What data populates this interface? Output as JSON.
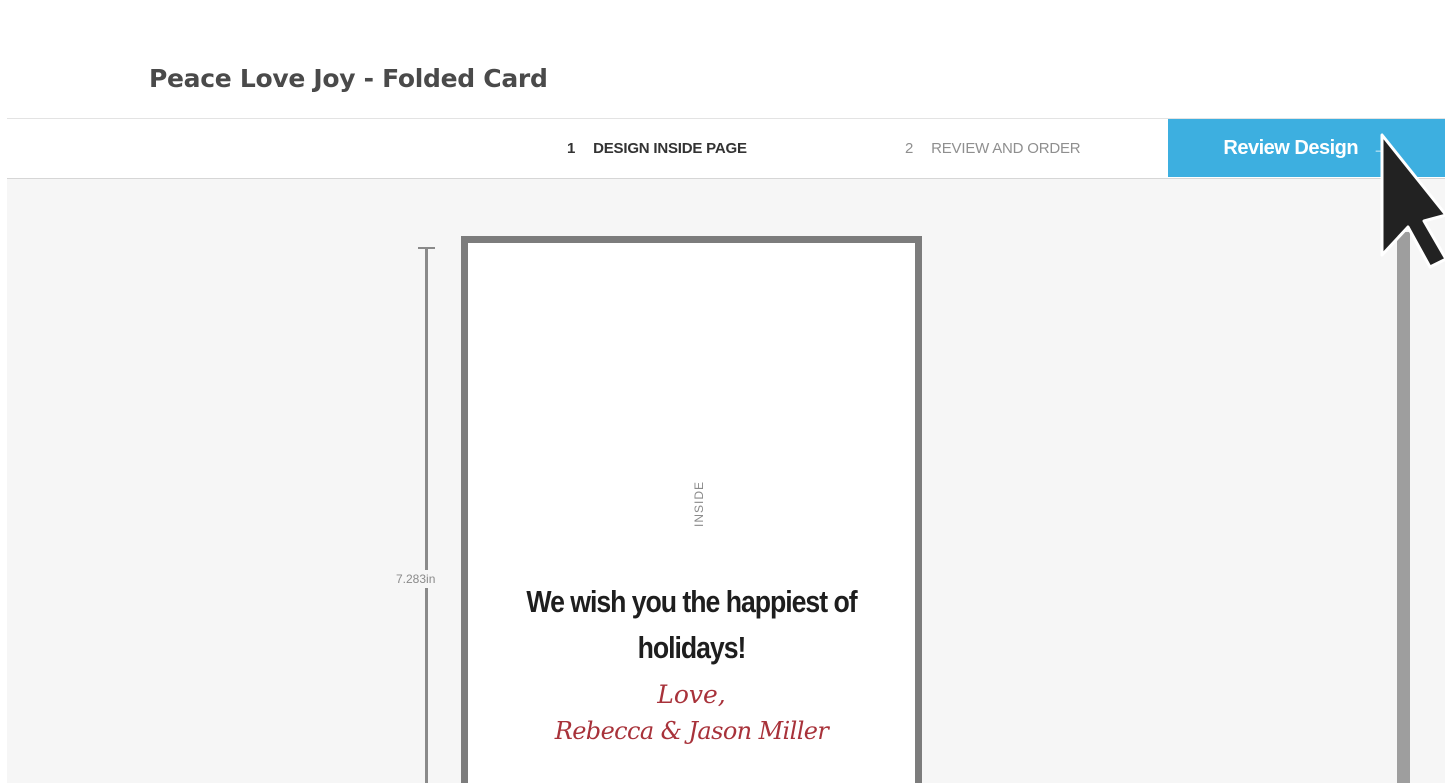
{
  "document": {
    "title": "Peace Love Joy - Folded Card"
  },
  "steps": [
    {
      "number": "1",
      "label": "DESIGN INSIDE PAGE",
      "active": true
    },
    {
      "number": "2",
      "label": "REVIEW AND ORDER",
      "active": false
    }
  ],
  "actions": {
    "review_label": "Review Design",
    "review_arrow": "→"
  },
  "canvas": {
    "dimension_label": "7.283in",
    "inside_label": "INSIDE",
    "greeting_line1": "We wish you the happiest of",
    "greeting_line2": "holidays!",
    "closing": "Love,",
    "signature": "Rebecca & Jason Miller"
  },
  "colors": {
    "accent": "#3dafe0",
    "signature": "#a8323a",
    "card_border": "#7c7c7c"
  },
  "icons": {
    "cursor": "mouse-pointer-icon"
  }
}
